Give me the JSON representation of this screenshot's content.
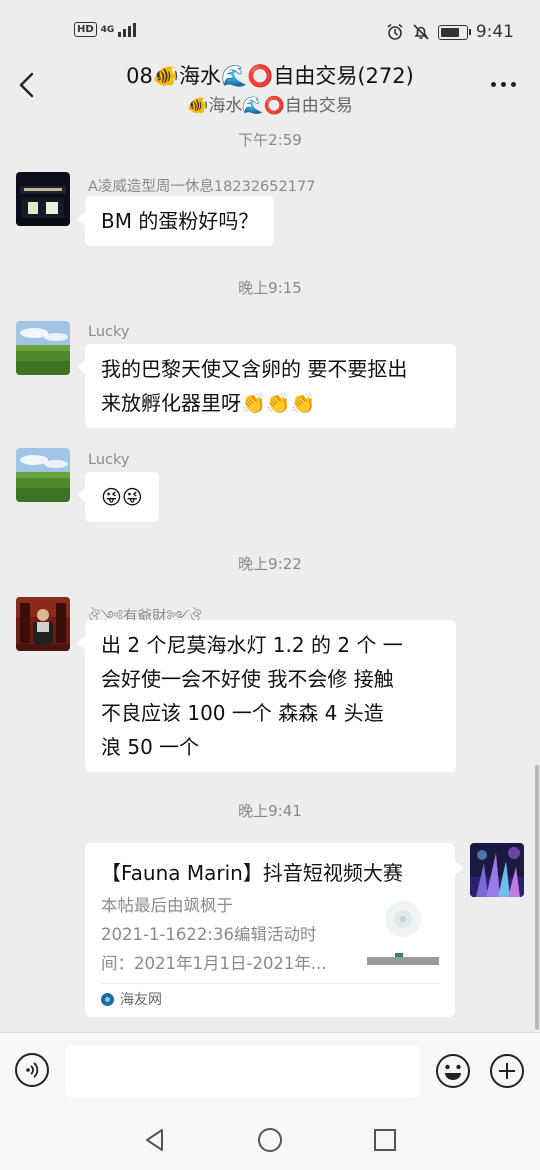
{
  "status_bar": {
    "network": "4G",
    "hd": "HD",
    "time": "9:41"
  },
  "header": {
    "title": "08🐠海水🌊⭕自由交易(272)",
    "subtitle": "🐠海水🌊⭕自由交易"
  },
  "messages": [
    {
      "type": "timestamp",
      "text": "下午2:59"
    },
    {
      "type": "message",
      "sender": "A凌威造型周一休息18232652177",
      "text": "BM 的蛋粉好吗？",
      "avatar": "shop-front-avatar"
    },
    {
      "type": "timestamp",
      "text": "晚上9:15"
    },
    {
      "type": "message",
      "sender": "Lucky",
      "line1": "我的巴黎天使又含卵的 要不要抠出",
      "line2": "来放孵化器里呀👏👏👏",
      "avatar": "green-field-avatar"
    },
    {
      "type": "message",
      "sender": "Lucky",
      "text": "😜😜",
      "avatar": "green-field-avatar"
    },
    {
      "type": "timestamp",
      "text": "晚上9:22"
    },
    {
      "type": "message",
      "sender": "ঔ༺有爺財༻ঔ",
      "line1": "出 2 个尼莫海水灯  1.2 的   2 个  一",
      "line2": "会好使一会不好使 我不会修  接触",
      "line3": "不良应该   100 一个    森森 4 头造",
      "line4": "浪   50 一个",
      "avatar": "man-portrait-avatar"
    },
    {
      "type": "timestamp",
      "text": "晚上9:41"
    },
    {
      "type": "link_card",
      "title": "【Fauna Marin】抖音短视频大赛",
      "desc_line1": "本帖最后由飒枫于",
      "desc_line2": "2021-1-1622:36编辑活动时",
      "desc_line3": "间：2021年1月1日-2021年...",
      "source": "海友网",
      "avatar": "coral-avatar"
    }
  ],
  "colors": {
    "background": "#ededed",
    "bubble": "#ffffff",
    "timestamp": "#8a8a8a"
  },
  "icons": {
    "back": "back-arrow-icon",
    "more": "more-options-icon",
    "voice": "voice-input-icon",
    "emoji": "emoji-icon",
    "plus": "plus-icon",
    "nav_back": "nav-back-icon",
    "nav_home": "nav-home-icon",
    "nav_recent": "nav-recent-icon"
  }
}
